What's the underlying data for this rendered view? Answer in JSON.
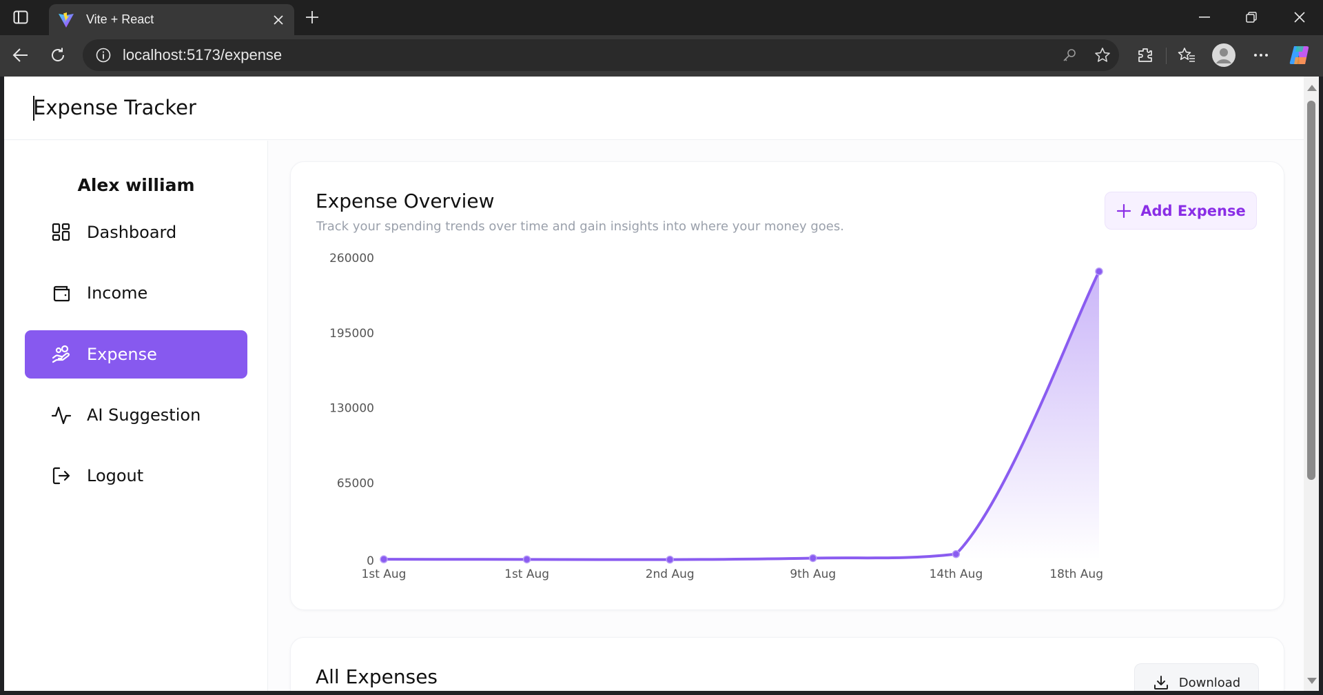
{
  "browser": {
    "tab_title": "Vite + React",
    "url": "localhost:5173/expense"
  },
  "app": {
    "title": "Expense Tracker"
  },
  "sidebar": {
    "user_name": "Alex william",
    "items": [
      {
        "label": "Dashboard",
        "icon": "dashboard-icon",
        "active": false
      },
      {
        "label": "Income",
        "icon": "wallet-icon",
        "active": false
      },
      {
        "label": "Expense",
        "icon": "hand-coins-icon",
        "active": true
      },
      {
        "label": "AI Suggestion",
        "icon": "activity-icon",
        "active": false
      },
      {
        "label": "Logout",
        "icon": "logout-icon",
        "active": false
      }
    ]
  },
  "overview": {
    "title": "Expense Overview",
    "subtitle": "Track your spending trends over time and gain insights into where your money goes.",
    "add_button": "Add Expense"
  },
  "all_expenses": {
    "title": "All Expenses",
    "download_button": "Download"
  },
  "colors": {
    "accent": "#8759ef",
    "line": "#8a5cf0",
    "add_text": "#8a2ee6"
  },
  "chart_data": {
    "type": "area",
    "categories": [
      "1st Aug",
      "1st Aug",
      "2nd Aug",
      "9th Aug",
      "14th Aug",
      "18th Aug"
    ],
    "values": [
      500,
      400,
      200,
      1500,
      5000,
      250000
    ],
    "yticks": [
      0,
      65000,
      130000,
      195000,
      260000
    ],
    "ylim": [
      0,
      260000
    ],
    "grid": false,
    "legend": "none"
  }
}
